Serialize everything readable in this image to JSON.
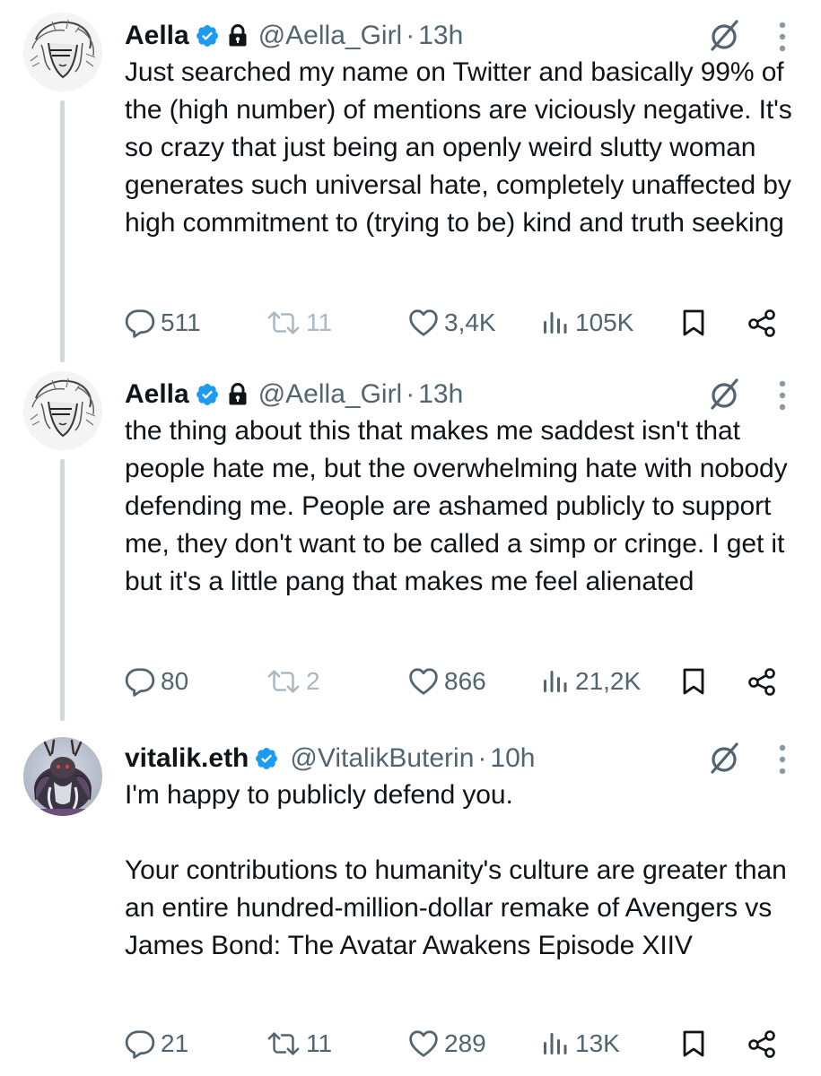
{
  "tweets": [
    {
      "name": "Aella",
      "handle": "@Aella_Girl",
      "separator": "·",
      "time": "13h",
      "text": "Just searched my name on Twitter and basically 99% of the (high number) of mentions are viciously negative. It's so crazy that just being an openly weird slutty woman generates such universal hate, completely unaffected by high commitment to (trying to be) kind and truth seeking",
      "replies": "511",
      "retweets": "11",
      "likes": "3,4K",
      "views": "105K"
    },
    {
      "name": "Aella",
      "handle": "@Aella_Girl",
      "separator": "·",
      "time": "13h",
      "text": "the thing about this that makes me saddest isn't that people hate me, but the overwhelming hate with nobody defending me. People are ashamed publicly to support me, they don't want to be called a simp or cringe. I get it but it's a little pang that makes me feel alienated",
      "replies": "80",
      "retweets": "2",
      "likes": "866",
      "views": "21,2K"
    },
    {
      "name": "vitalik.eth",
      "handle": "@VitalikButerin",
      "separator": "·",
      "time": "10h",
      "text": "I'm happy to publicly defend you.\n\nYour contributions to humanity's culture are greater than an entire hundred-million-dollar remake of Avengers vs James Bond: The Avatar Awakens Episode XIIV",
      "replies": "21",
      "retweets": "11",
      "likes": "289",
      "views": "13K"
    }
  ],
  "icons": {
    "verified": "verified-badge-icon",
    "locked": "lock-icon",
    "grok": "grok-icon",
    "more": "more-vertical-icon",
    "reply": "reply-icon",
    "retweet": "retweet-icon",
    "like": "heart-icon",
    "views": "views-icon",
    "bookmark": "bookmark-icon",
    "share": "share-icon"
  },
  "colors": {
    "verified": "#1d9bf0",
    "text": "#0f1419",
    "secondary": "#536471",
    "retweet_disabled": "#aab8c2",
    "thread_line": "#cfd9de"
  }
}
